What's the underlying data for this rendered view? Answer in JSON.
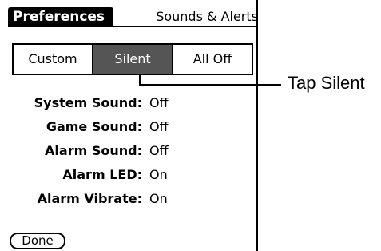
{
  "header": {
    "title": "Preferences",
    "category": "Sounds & Alerts"
  },
  "profile_selector": {
    "options": [
      "Custom",
      "Silent",
      "All Off"
    ],
    "selected": "Silent"
  },
  "settings": [
    {
      "label": "System Sound:",
      "value": "Off"
    },
    {
      "label": "Game Sound:",
      "value": "Off"
    },
    {
      "label": "Alarm Sound:",
      "value": "Off"
    },
    {
      "label": "Alarm LED:",
      "value": "On"
    },
    {
      "label": "Alarm Vibrate:",
      "value": "On"
    }
  ],
  "footer": {
    "done_label": "Done"
  },
  "annotation": {
    "text": "Tap Silent"
  },
  "colors": {
    "selected_segment": "#555555",
    "title_tab": "#000000"
  }
}
